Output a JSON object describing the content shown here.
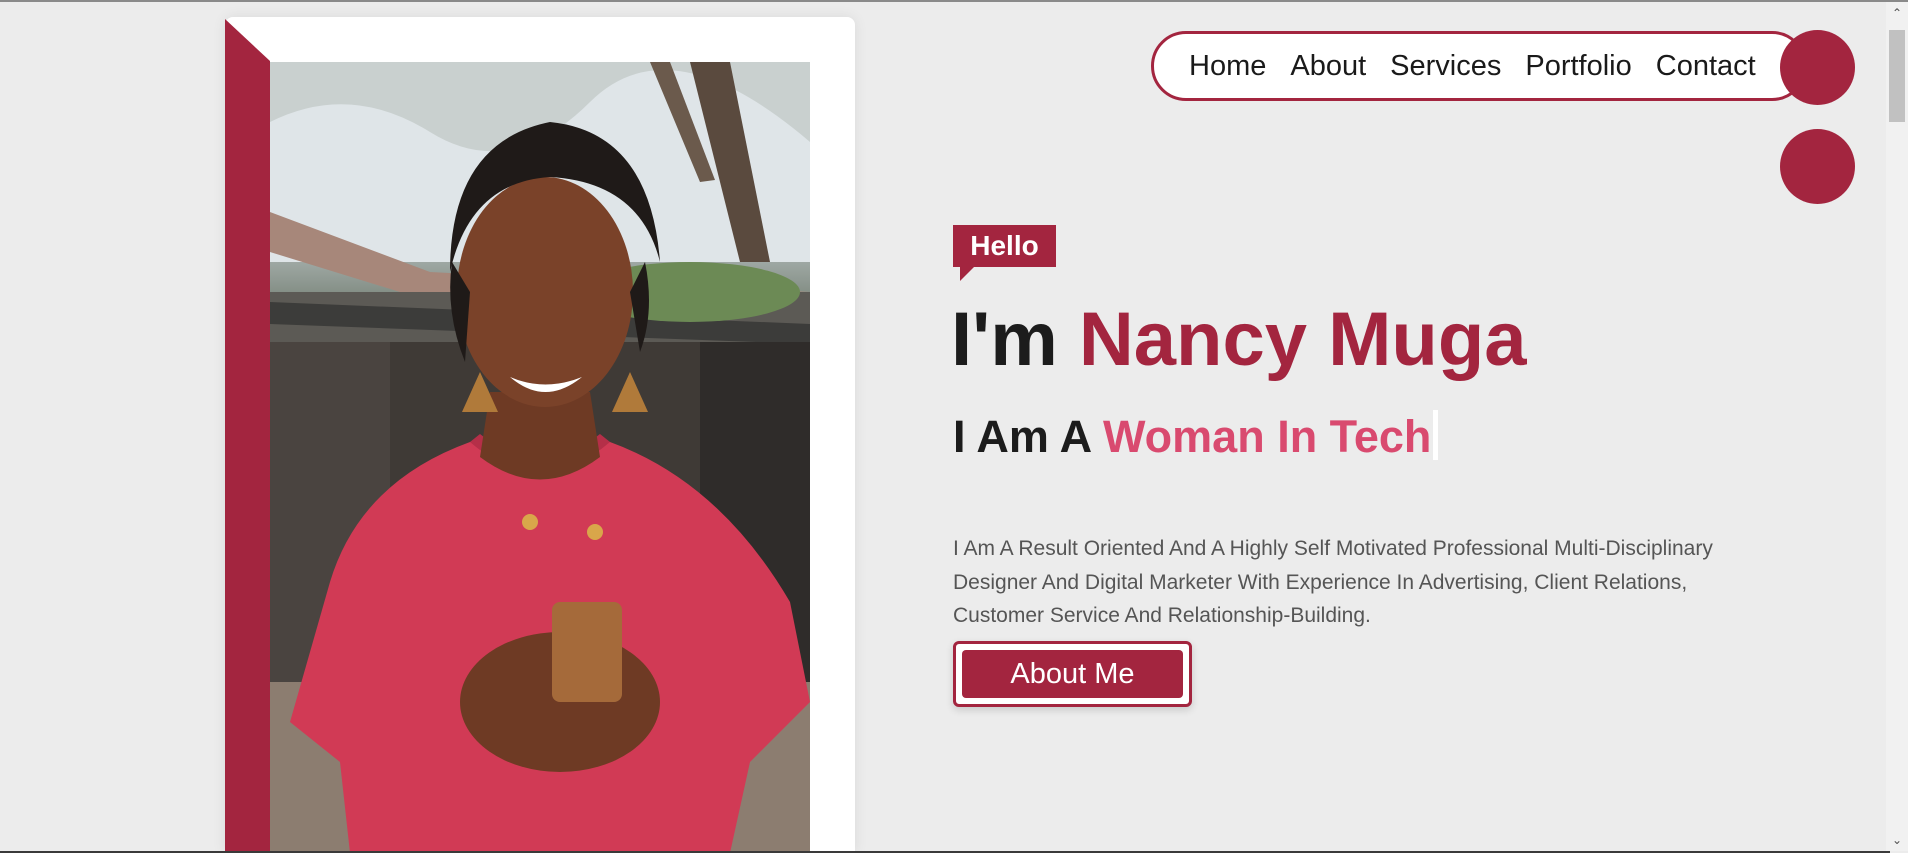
{
  "nav": {
    "items": [
      {
        "label": "Home"
      },
      {
        "label": "About"
      },
      {
        "label": "Services"
      },
      {
        "label": "Portfolio"
      },
      {
        "label": "Contact"
      }
    ]
  },
  "hero": {
    "greeting": "Hello",
    "headline_prefix": "I'm ",
    "name": "Nancy Muga",
    "subhead_prefix": "I Am A ",
    "role": "Woman In Tech",
    "bio": "I Am A Result Oriented And A Highly Self Motivated Professional Multi-Disciplinary Designer And Digital Marketer With Experience In Advertising, Client Relations, Customer Service And Relationship-Building.",
    "cta_label": "About Me"
  },
  "colors": {
    "accent": "#a3253f",
    "role_pink": "#d94a6f",
    "background": "#ececec"
  },
  "icons": {
    "scroll_up": "chevron-up-icon",
    "scroll_down": "chevron-down-icon"
  }
}
